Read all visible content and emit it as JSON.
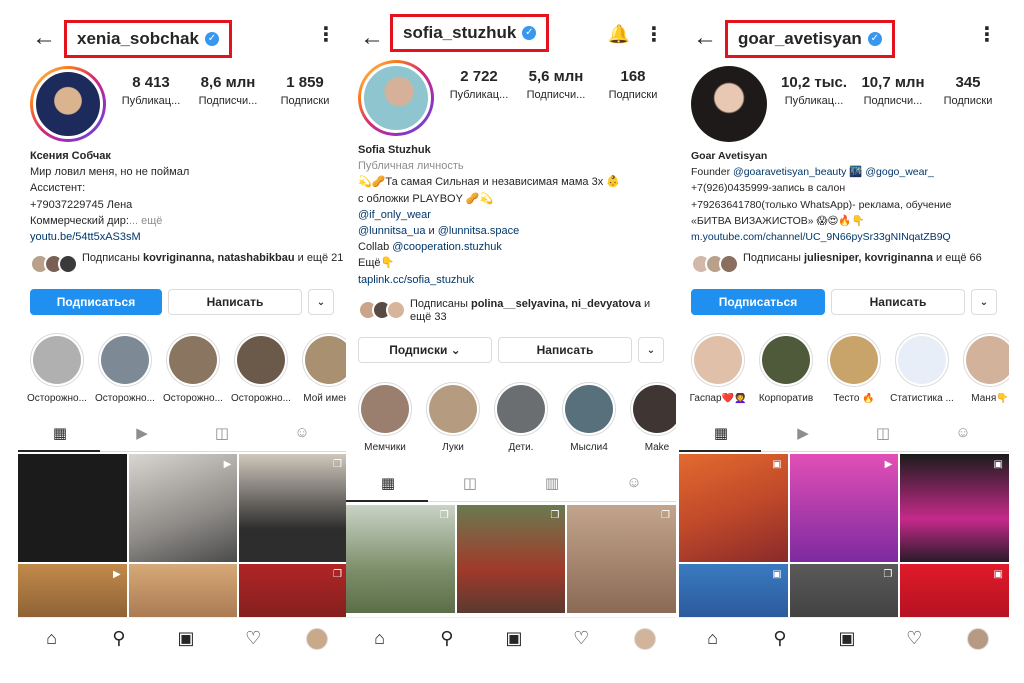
{
  "common": {
    "back_icon": "arrow-left-icon",
    "more_icon": "more-vertical-icon",
    "verified_icon": "verified-check-icon",
    "verified_glyph": "✓",
    "nav": [
      "home-icon",
      "search-icon",
      "reels-icon",
      "heart-icon",
      "profile-avatar"
    ]
  },
  "profiles": [
    {
      "handle": "xenia_sobchak",
      "stats": [
        {
          "num": "8 413",
          "label": "Публикац..."
        },
        {
          "num": "8,6 млн",
          "label": "Подписчи..."
        },
        {
          "num": "1 859",
          "label": "Подписки"
        }
      ],
      "bio": {
        "name": "Ксения Собчак",
        "lines": [
          "Мир ловил меня, но не поймал",
          "Ассистент:",
          "+79037229745 Лена"
        ],
        "last_line": "Коммерческий дир:",
        "more": "... ещё",
        "link": "youtu.be/54tt5xAS3sM"
      },
      "followed_by": {
        "prefix": "Подписаны ",
        "names": "kovriginanna, natashabikbau",
        "suffix": " и ещё 21"
      },
      "buttons": {
        "follow": "Подписаться",
        "message": "Написать",
        "dropdown": "⌄"
      },
      "highlights": [
        "Осторожно...",
        "Осторожно...",
        "Осторожно...",
        "Осторожно...",
        "Мой имени"
      ]
    },
    {
      "handle": "sofia_stuzhuk",
      "stats": [
        {
          "num": "2 722",
          "label": "Публикац..."
        },
        {
          "num": "5,6 млн",
          "label": "Подписчи..."
        },
        {
          "num": "168",
          "label": "Подписки"
        }
      ],
      "bio": {
        "name": "Sofia Stuzhuk",
        "category": "Публичная личность",
        "line1": "💫🥜Та самая Сильная и независимая мама 3х 👶",
        "line2": "с обложки PLAYBOY 🥜💫",
        "link1": "@if_only_wear",
        "link2a": "@lunnitsa_ua",
        "and": " и ",
        "link2b": "@lunnitsa.space",
        "collab": "Collab ",
        "link3": "@cooperation.stuzhuk",
        "more": "Ещё👇",
        "link4": "taplink.cc/sofia_stuzhuk"
      },
      "followed_by": {
        "prefix": "Подписаны ",
        "names": "polina__selyavina, ni_devyatova",
        "suffix": " и ещё 33"
      },
      "buttons": {
        "subscriptions": "Подписки ⌄",
        "message": "Написать",
        "dropdown": "⌄"
      },
      "highlights": [
        "Мемчики",
        "Луки",
        "Дети.",
        "Мысли4",
        "Make"
      ]
    },
    {
      "handle": "goar_avetisyan",
      "stats": [
        {
          "num": "10,2 тыс.",
          "label": "Публикац..."
        },
        {
          "num": "10,7 млн",
          "label": "Подписчи..."
        },
        {
          "num": "345",
          "label": "Подписки"
        }
      ],
      "bio": {
        "name": "Goar Avetisyan",
        "founder": "Founder ",
        "link1": "@goaravetisyan_beauty",
        "mid": " 🌃 ",
        "link2": "@gogo_wear_",
        "line2": "+7(926)0435999-запись в салон",
        "line3": "+79263641780(только WhatsApp)- реклама, обучение",
        "line4": "«БИТВА ВИЗАЖИСТОВ» 😱😍🔥👇",
        "link3": "m.youtube.com/channel/UC_9N66pySr33gNINqatZB9Q"
      },
      "followed_by": {
        "prefix": "Подписаны ",
        "names": "juliesniper, kovriginanna",
        "suffix": " и ещё 66"
      },
      "buttons": {
        "follow": "Подписаться",
        "message": "Написать",
        "dropdown": "⌄"
      },
      "highlights": [
        "Гаспар❤️👩‍🦱",
        "Корпоратив",
        "Тесто 🔥",
        "Статистика ...",
        "Маня👇"
      ]
    }
  ],
  "colors": {
    "accent": "#1f90f0",
    "highlight_box": "#e3121d",
    "verified": "#3897f0",
    "link": "#00376b"
  }
}
